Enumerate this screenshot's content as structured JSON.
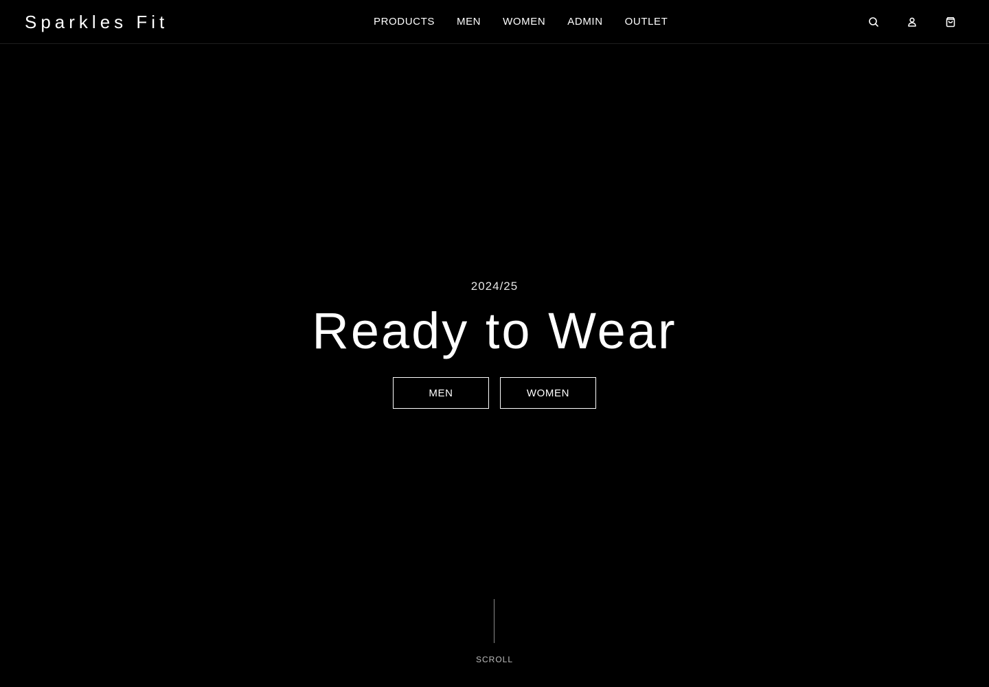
{
  "header": {
    "brand": "Sparkles Fit",
    "nav": [
      {
        "label": "PRODUCTS"
      },
      {
        "label": "MEN"
      },
      {
        "label": "WOMEN"
      },
      {
        "label": "ADMIN"
      },
      {
        "label": "OUTLET"
      }
    ],
    "icons": {
      "search": "search-icon",
      "account": "user-icon",
      "cart": "shopping-bag-icon"
    }
  },
  "hero": {
    "season": "2024/25",
    "title": "Ready to Wear",
    "buttons": [
      {
        "label": "MEN"
      },
      {
        "label": "WOMEN"
      }
    ],
    "scroll_label": "SCROLL"
  },
  "colors": {
    "background": "#000000",
    "text": "#ffffff",
    "muted": "#bfbfbf"
  }
}
